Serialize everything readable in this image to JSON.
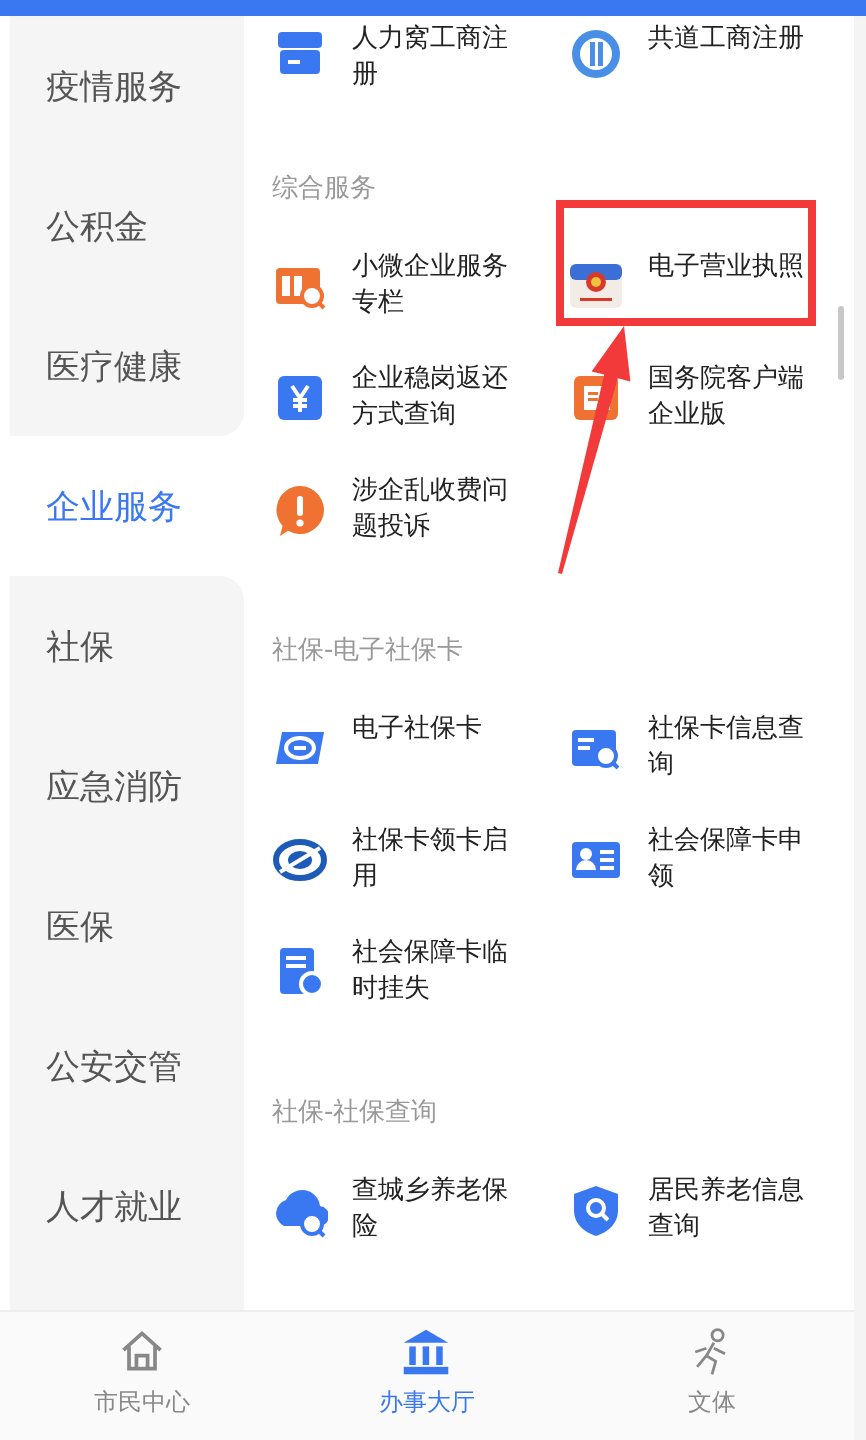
{
  "sidebar": {
    "items": [
      {
        "label": "疫情服务",
        "selected": false
      },
      {
        "label": "公积金",
        "selected": false
      },
      {
        "label": "医疗健康",
        "selected": false
      },
      {
        "label": "企业服务",
        "selected": true
      },
      {
        "label": "社保",
        "selected": false
      },
      {
        "label": "应急消防",
        "selected": false
      },
      {
        "label": "医保",
        "selected": false
      },
      {
        "label": "公安交管",
        "selected": false
      },
      {
        "label": "人才就业",
        "selected": false
      }
    ]
  },
  "sections": [
    {
      "items": [
        "人力窝工商注册",
        "共道工商注册"
      ]
    },
    {
      "title": "综合服务",
      "items": [
        "小微企业服务专栏",
        "电子营业执照",
        "企业稳岗返还方式查询",
        "国务院客户端企业版",
        "涉企乱收费问题投诉"
      ]
    },
    {
      "title": "社保-电子社保卡",
      "items": [
        "电子社保卡",
        "社保卡信息查询",
        "社保卡领卡启用",
        "社会保障卡申领",
        "社会保障卡临时挂失"
      ]
    },
    {
      "title": "社保-社保查询",
      "items": [
        "查城乡养老保险",
        "居民养老信息查询"
      ]
    }
  ],
  "tab_bar": {
    "tabs": [
      {
        "label": "市民中心",
        "selected": false
      },
      {
        "label": "办事大厅",
        "selected": true
      },
      {
        "label": "文体",
        "selected": false
      }
    ]
  }
}
